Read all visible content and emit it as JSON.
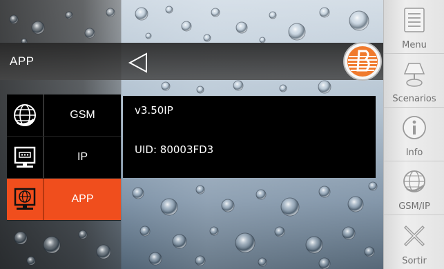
{
  "header": {
    "title": "APP"
  },
  "left_menu": {
    "items": [
      {
        "label": "GSM",
        "icon": "globe-icon",
        "active": false
      },
      {
        "label": "IP",
        "icon": "monitor-icon",
        "active": false
      },
      {
        "label": "APP",
        "icon": "monitor-globe-icon",
        "active": true
      }
    ]
  },
  "info_panel": {
    "version": "v3.50IP",
    "uid": "UID: 80003FD3"
  },
  "sidebar": {
    "items": [
      {
        "label": "Menu",
        "icon": "menu-icon"
      },
      {
        "label": "Scenarios",
        "icon": "lamp-icon"
      },
      {
        "label": "Info",
        "icon": "info-icon"
      },
      {
        "label": "GSM/IP",
        "icon": "globe-icon"
      },
      {
        "label": "Sortir",
        "icon": "close-x-icon"
      }
    ]
  },
  "colors": {
    "accent": "#f04e1d",
    "panel": "#000000",
    "sidebar_label": "#6f6f6f"
  }
}
